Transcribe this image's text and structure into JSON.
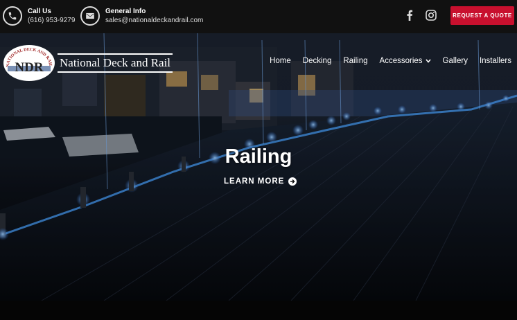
{
  "topbar": {
    "phone": {
      "label": "Call Us",
      "value": "(616) 953-9279",
      "icon": "phone-icon"
    },
    "email": {
      "label": "General Info",
      "value": "sales@nationaldeckandrail.com",
      "icon": "envelope-icon"
    },
    "social": [
      {
        "icon": "facebook-icon"
      },
      {
        "icon": "instagram-icon"
      }
    ],
    "quote_label": "REQUEST A QUOTE",
    "quote_color": "#c8102e"
  },
  "logo": {
    "initials": "NDR",
    "arc_text": "NATIONAL DECK AND RAIL",
    "name": "National Deck and Rail"
  },
  "nav": {
    "items": [
      {
        "label": "Home"
      },
      {
        "label": "Decking"
      },
      {
        "label": "Railing"
      },
      {
        "label": "Accessories",
        "has_dropdown": true
      },
      {
        "label": "Gallery"
      },
      {
        "label": "Installers"
      }
    ]
  },
  "hero": {
    "title": "Railing",
    "cta": "LEARN MORE"
  }
}
